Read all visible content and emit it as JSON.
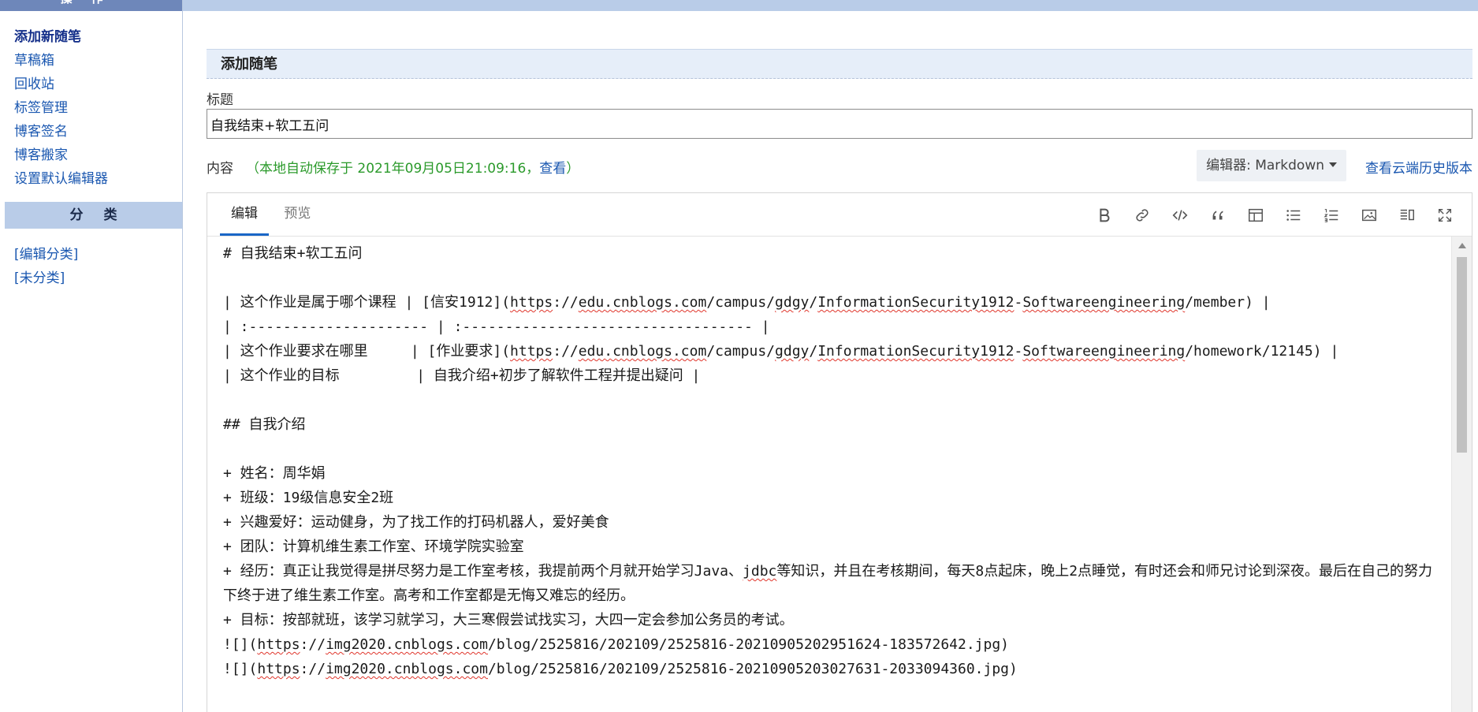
{
  "sidebar": {
    "header": "操作",
    "items": [
      {
        "label": "添加新随笔",
        "active": true
      },
      {
        "label": "草稿箱"
      },
      {
        "label": "回收站"
      },
      {
        "label": "标签管理"
      },
      {
        "label": "博客签名"
      },
      {
        "label": "博客搬家"
      },
      {
        "label": "设置默认编辑器"
      }
    ],
    "category_header": "分类",
    "categories": [
      {
        "label": "[编辑分类]"
      },
      {
        "label": "[未分类]"
      }
    ]
  },
  "main": {
    "section_title": "添加随笔",
    "title_label": "标题",
    "title_value": "自我结束+软工五问",
    "content_label": "内容",
    "autosave_text": "（本地自动保存于 2021年09月05日21:09:16，",
    "autosave_link": "查看",
    "autosave_close": "）",
    "editor_select": "编辑器: Markdown",
    "cloud_history": "查看云端历史版本"
  },
  "editor": {
    "tabs": [
      {
        "label": "编辑",
        "active": true
      },
      {
        "label": "预览"
      }
    ],
    "toolbar": [
      "bold-icon",
      "link-icon",
      "code-icon",
      "quote-icon",
      "table-icon",
      "unordered-list-icon",
      "ordered-list-icon",
      "image-icon",
      "split-view-icon",
      "fullscreen-icon"
    ],
    "lines": [
      "# 自我结束+软工五问",
      "",
      "| 这个作业是属于哪个课程 | [信安1912](https://edu.cnblogs.com/campus/gdgy/InformationSecurity1912-Softwareengineering/member) |",
      "| :--------------------- | :---------------------------------- |",
      "| 这个作业要求在哪里     | [作业要求](https://edu.cnblogs.com/campus/gdgy/InformationSecurity1912-Softwareengineering/homework/12145) |",
      "| 这个作业的目标         | 自我介绍+初步了解软件工程并提出疑问 |",
      "",
      "## 自我介绍",
      "",
      "+ 姓名：周华娟",
      "+ 班级：19级信息安全2班",
      "+ 兴趣爱好：运动健身，为了找工作的打码机器人，爱好美食",
      "+ 团队：计算机维生素工作室、环境学院实验室",
      "+ 经历：真正让我觉得是拼尽努力是工作室考核，我提前两个月就开始学习Java、jdbc等知识，并且在考核期间，每天8点起床，晚上2点睡觉，有时还会和师兄讨论到深夜。最后在自己的努力下终于进了维生素工作室。高考和工作室都是无悔又难忘的经历。",
      "+ 目标：按部就班，该学习就学习，大三寒假尝试找实习，大四一定会参加公务员的考试。",
      "![](https://img2020.cnblogs.com/blog/2525816/202109/2525816-20210905202951624-183572642.jpg)",
      "![](https://img2020.cnblogs.com/blog/2525816/202109/2525816-20210905203027631-2033094360.jpg)"
    ]
  }
}
